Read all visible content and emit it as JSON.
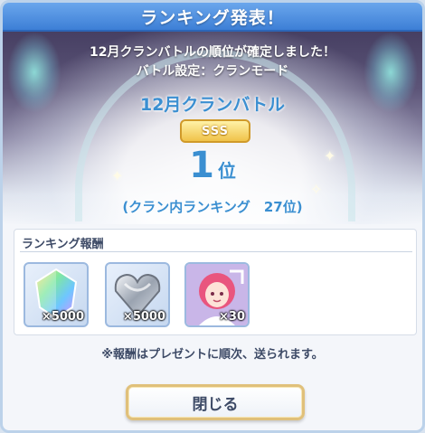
{
  "dialog": {
    "title": "ランキング発表！"
  },
  "result": {
    "message_line1": "12月クランバトルの順位が確定しました！",
    "message_line2": "バトル設定：クランモード",
    "battle_name": "12月クランバトル",
    "rank_badge": "SSS",
    "position_number": "1",
    "position_unit": "位",
    "clan_internal_rank": "(クラン内ランキング　27位)"
  },
  "rewards": {
    "heading": "ランキング報酬",
    "items": [
      {
        "icon": "rainbow-gem-icon",
        "quantity": "×5000"
      },
      {
        "icon": "silver-heart-stone-icon",
        "quantity": "×5000"
      },
      {
        "icon": "character-memory-piece-icon",
        "quantity": "×30"
      }
    ]
  },
  "notice": "※報酬はプレゼントに順次、送られます。",
  "close_button_label": "閉じる",
  "colors": {
    "title_bar": "#3d7fd6",
    "accent_text": "#3b8fd1",
    "badge_gold": "#f0c34a",
    "button_border": "#e0c07a"
  }
}
